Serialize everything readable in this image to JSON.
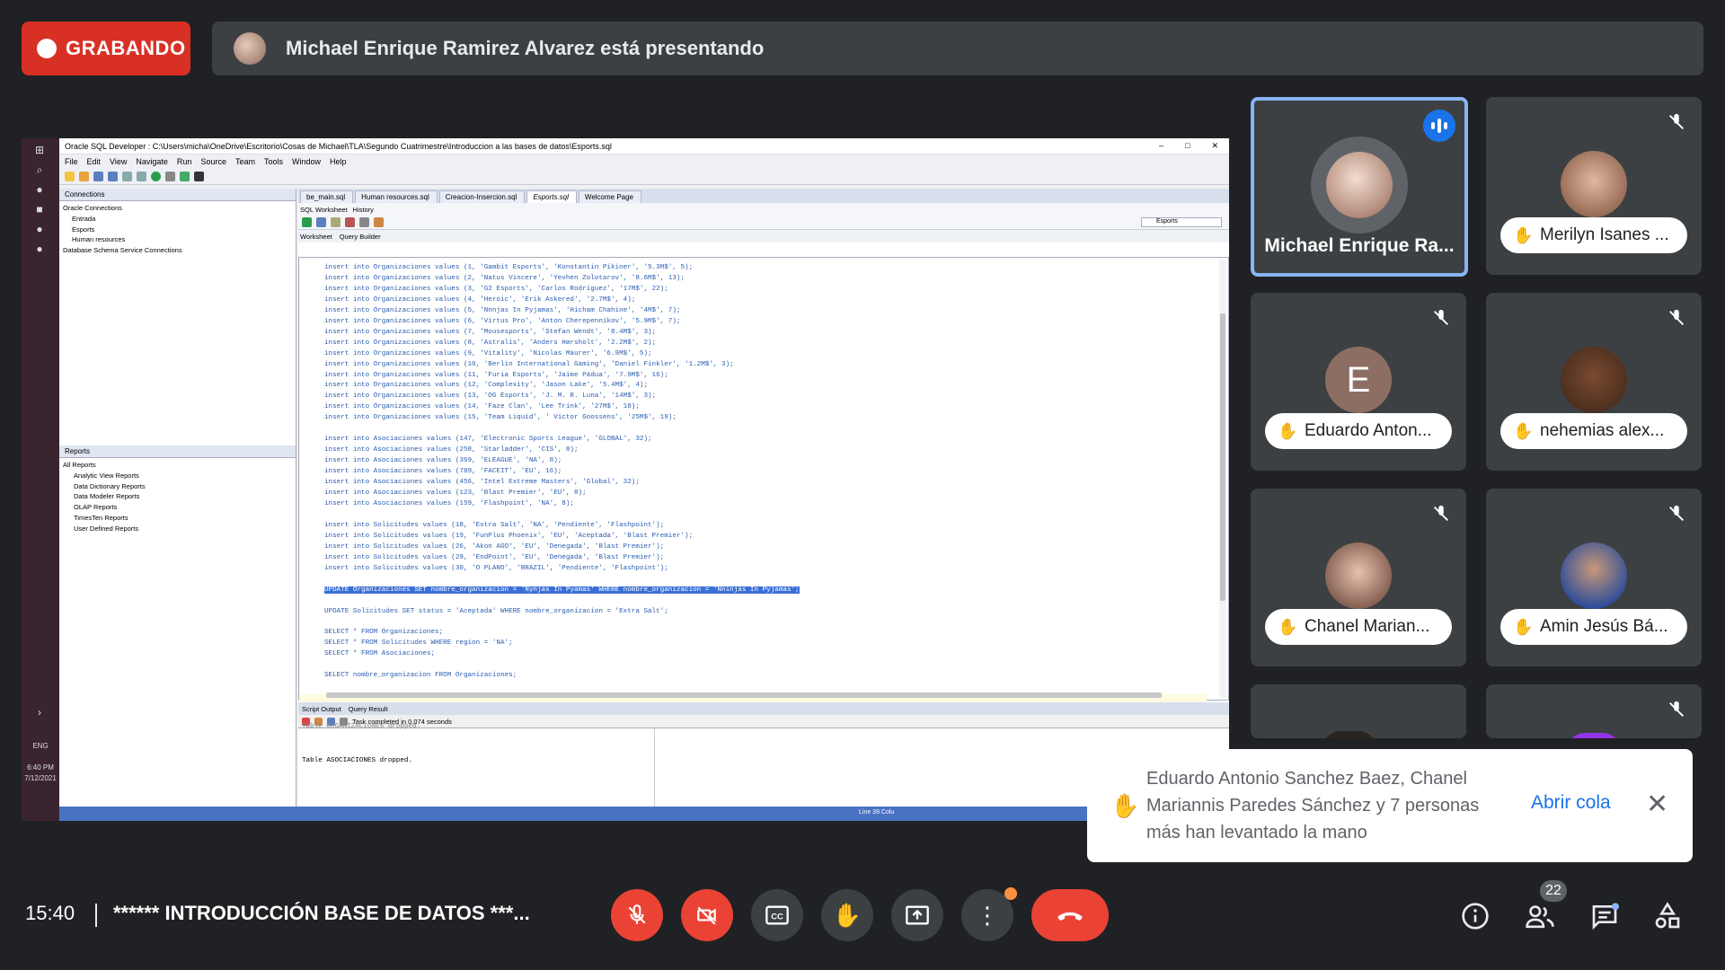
{
  "recording": {
    "label": "GRABANDO"
  },
  "presenter_banner": {
    "text": "Michael Enrique Ramirez Alvarez está presentando"
  },
  "ide": {
    "title": "Oracle SQL Developer : C:\\Users\\micha\\OneDrive\\Escritorio\\Cosas de Michael\\TLA\\Segundo Cuatrimestre\\Introduccion a las bases de datos\\Esports.sql",
    "menu": [
      "File",
      "Edit",
      "View",
      "Navigate",
      "Run",
      "Source",
      "Team",
      "Tools",
      "Window",
      "Help"
    ],
    "connections_header": "Connections",
    "connections_tree": [
      "Oracle Connections",
      "Entrada",
      "Esports",
      "Human resources",
      "Database Schema Service Connections"
    ],
    "reports_header": "Reports",
    "reports_tree": [
      "All Reports",
      "Analytic View Reports",
      "Data Dictionary Reports",
      "Data Modeler Reports",
      "OLAP Reports",
      "TimesTen Reports",
      "User Defined Reports"
    ],
    "doc_tabs": [
      "be_main.sql",
      "Human resources.sql",
      "Creacion-Insercion.sql",
      "Esports.sql",
      "Welcome Page"
    ],
    "sub_tabs": [
      "SQL Worksheet",
      "History"
    ],
    "ws_tabs": [
      "Worksheet",
      "Query Builder"
    ],
    "connection_select": "Esports",
    "code_lines": [
      "insert into Organizaciones values (1, 'Gambit Esports', 'Konstantin Pikiner', '5.3M$', 5);",
      "insert into Organizaciones values (2, 'Natus Vincere', 'Yevhen Zolotarov', '8.6M$', 13);",
      "insert into Organizaciones values (3, 'G2 Esports', 'Carlos Rodriguez', '17M$', 22);",
      "insert into Organizaciones values (4, 'Heroic', 'Erik Askered', '2.7M$', 4);",
      "insert into Organizaciones values (5, 'Nnnjas In Pyjamas', 'Hicham Chahine', '4M$', 7);",
      "insert into Organizaciones values (6, 'Virtus Pro', 'Anton Cherepennikov', '5.9M$', 7);",
      "insert into Organizaciones values (7, 'Mousesports', 'Stefan Wendt', '8.4M$', 3);",
      "insert into Organizaciones values (8, 'Astralis', 'Anders Hørsholt', '2.2M$', 2);",
      "insert into Organizaciones values (9, 'Vitality', 'Nicolas Maurer', '6.9M$', 5);",
      "insert into Organizaciones values (10, 'Berlin International Gaming', 'Daniel Finkler', '1.2M$', 3);",
      "insert into Organizaciones values (11, 'Furia Esports', 'Jaime Pádua', '7.9M$', 16);",
      "insert into Organizaciones values (12, 'Complexity', 'Jason Lake', '5.4M$', 4);",
      "insert into Organizaciones values (13, 'OG Esports', 'J. M. R. Luna', '14M$', 3);",
      "insert into Organizaciones values (14, 'Faze Clan', 'Lee Trink', '27M$', 18);",
      "insert into Organizaciones values (15, 'Team Liquid', ' Victor Goossens', '25M$', 19);",
      "",
      "insert into Asociaciones values (147, 'Electronic Sports League', 'GLOBAL', 32);",
      "insert into Asociaciones values (258, 'Starladder', 'CIS', 8);",
      "insert into Asociaciones values (369, 'ELEAGUE', 'NA', 8);",
      "insert into Asociaciones values (789, 'FACEIT', 'EU', 16);",
      "insert into Asociaciones values (456, 'Intel Extreme Masters', 'Global', 32);",
      "insert into Asociaciones values (123, 'Blast Premier', 'EU', 8);",
      "insert into Asociaciones values (159, 'Flashpoint', 'NA', 8);",
      "",
      "insert into Solicitudes values (18, 'Extra Salt', 'NA', 'Pendiente', 'Flashpoint');",
      "insert into Solicitudes values (19, 'FunPlus Phoenix', 'EU', 'Aceptada', 'Blast Premier');",
      "insert into Solicitudes values (26, 'Akon AGO', 'EU', 'Denegada', 'Blast Premier');",
      "insert into Solicitudes values (29, 'EndPoint', 'EU', 'Denegada', 'Blast Premier');",
      "insert into Solicitudes values (30, 'O PLANO', 'BRAZIL', 'Pendiente', 'Flashpoint');",
      "",
      "UPDATE Organizaciones SET nombre_organizacion = 'Nynjas In Pyamas' WHERE nombre_organizacion = 'Nninjas In Pyjamas';",
      "",
      "UPDATE Solicitudes SET status = 'Aceptada' WHERE nombre_organizacion = 'Extra Salt';",
      "",
      "SELECT * FROM Organizaciones;",
      "SELECT * FROM Solicitudes WHERE region = 'NA';",
      "SELECT * FROM Asociaciones;",
      "",
      "SELECT nombre_organizacion FROM Organizaciones;"
    ],
    "output_tabs": [
      "Script Output",
      "Query Result"
    ],
    "task_status": "Task completed in 0.074 seconds",
    "output_line_top": "Table ORGANIZACIONES dropped.",
    "output_line": "Table ASOCIACIONES dropped.",
    "status_right": "Line 39 Colu"
  },
  "taskbar": {
    "lang": "ENG",
    "clock_time": "6:40 PM",
    "clock_date": "7/12/2021"
  },
  "participants": [
    {
      "name": "Michael Enrique Ra...",
      "state": "speaking"
    },
    {
      "name": "Merilyn Isanes ...",
      "state": "hand"
    },
    {
      "name": "Eduardo Anton...",
      "initial": "E",
      "state": "hand"
    },
    {
      "name": "nehemias alex...",
      "state": "hand"
    },
    {
      "name": "Chanel Marian...",
      "state": "hand"
    },
    {
      "name": "Amin Jesús Bá...",
      "state": "hand"
    }
  ],
  "notification": {
    "message": "Eduardo Antonio Sanchez Baez, Chanel Mariannis Paredes Sánchez y 7 personas más han levantado la mano",
    "action": "Abrir cola"
  },
  "bottom": {
    "time": "15:40",
    "meeting_title": "****** INTRODUCCIÓN BASE DE DATOS ***...",
    "participants_count": "22"
  },
  "colors": {
    "recording": "#d93025",
    "accent": "#1a73e8",
    "end_call": "#ea4335"
  }
}
